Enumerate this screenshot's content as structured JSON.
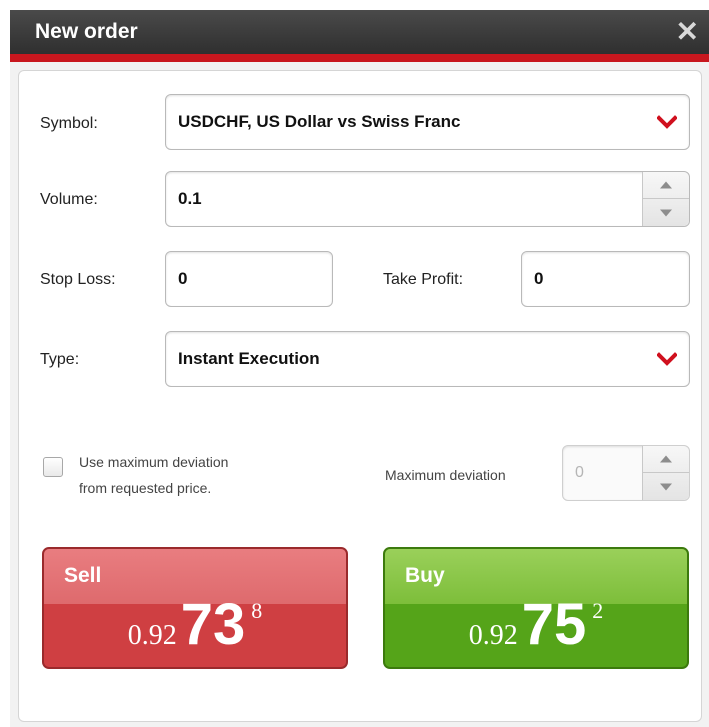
{
  "window": {
    "title": "New order",
    "close_glyph": "✕"
  },
  "symbol": {
    "label": "Symbol:",
    "value": "USDCHF, US Dollar vs Swiss Franc"
  },
  "volume": {
    "label": "Volume:",
    "value": "0.1"
  },
  "stop_loss": {
    "label": "Stop Loss:",
    "value": "0"
  },
  "take_profit": {
    "label": "Take Profit:",
    "value": "0"
  },
  "type": {
    "label": "Type:",
    "value": "Instant Execution"
  },
  "deviation": {
    "checkbox_label_line1": "Use maximum deviation",
    "checkbox_label_line2": "from requested price.",
    "checked": false,
    "label": "Maximum deviation",
    "value": "0"
  },
  "sell": {
    "label": "Sell",
    "price_prefix": "0.92",
    "price_big": "73",
    "price_sup": "8"
  },
  "buy": {
    "label": "Buy",
    "price_prefix": "0.92",
    "price_big": "75",
    "price_sup": "2"
  },
  "colors": {
    "accent_red": "#c8171e",
    "sell": "#cf3f42",
    "buy": "#55a419",
    "chevron": "#d0101e"
  },
  "icons": {
    "close": "close-icon",
    "dropdown": "chevron-down-icon",
    "spin_up": "spin-up-icon",
    "spin_down": "spin-down-icon"
  }
}
